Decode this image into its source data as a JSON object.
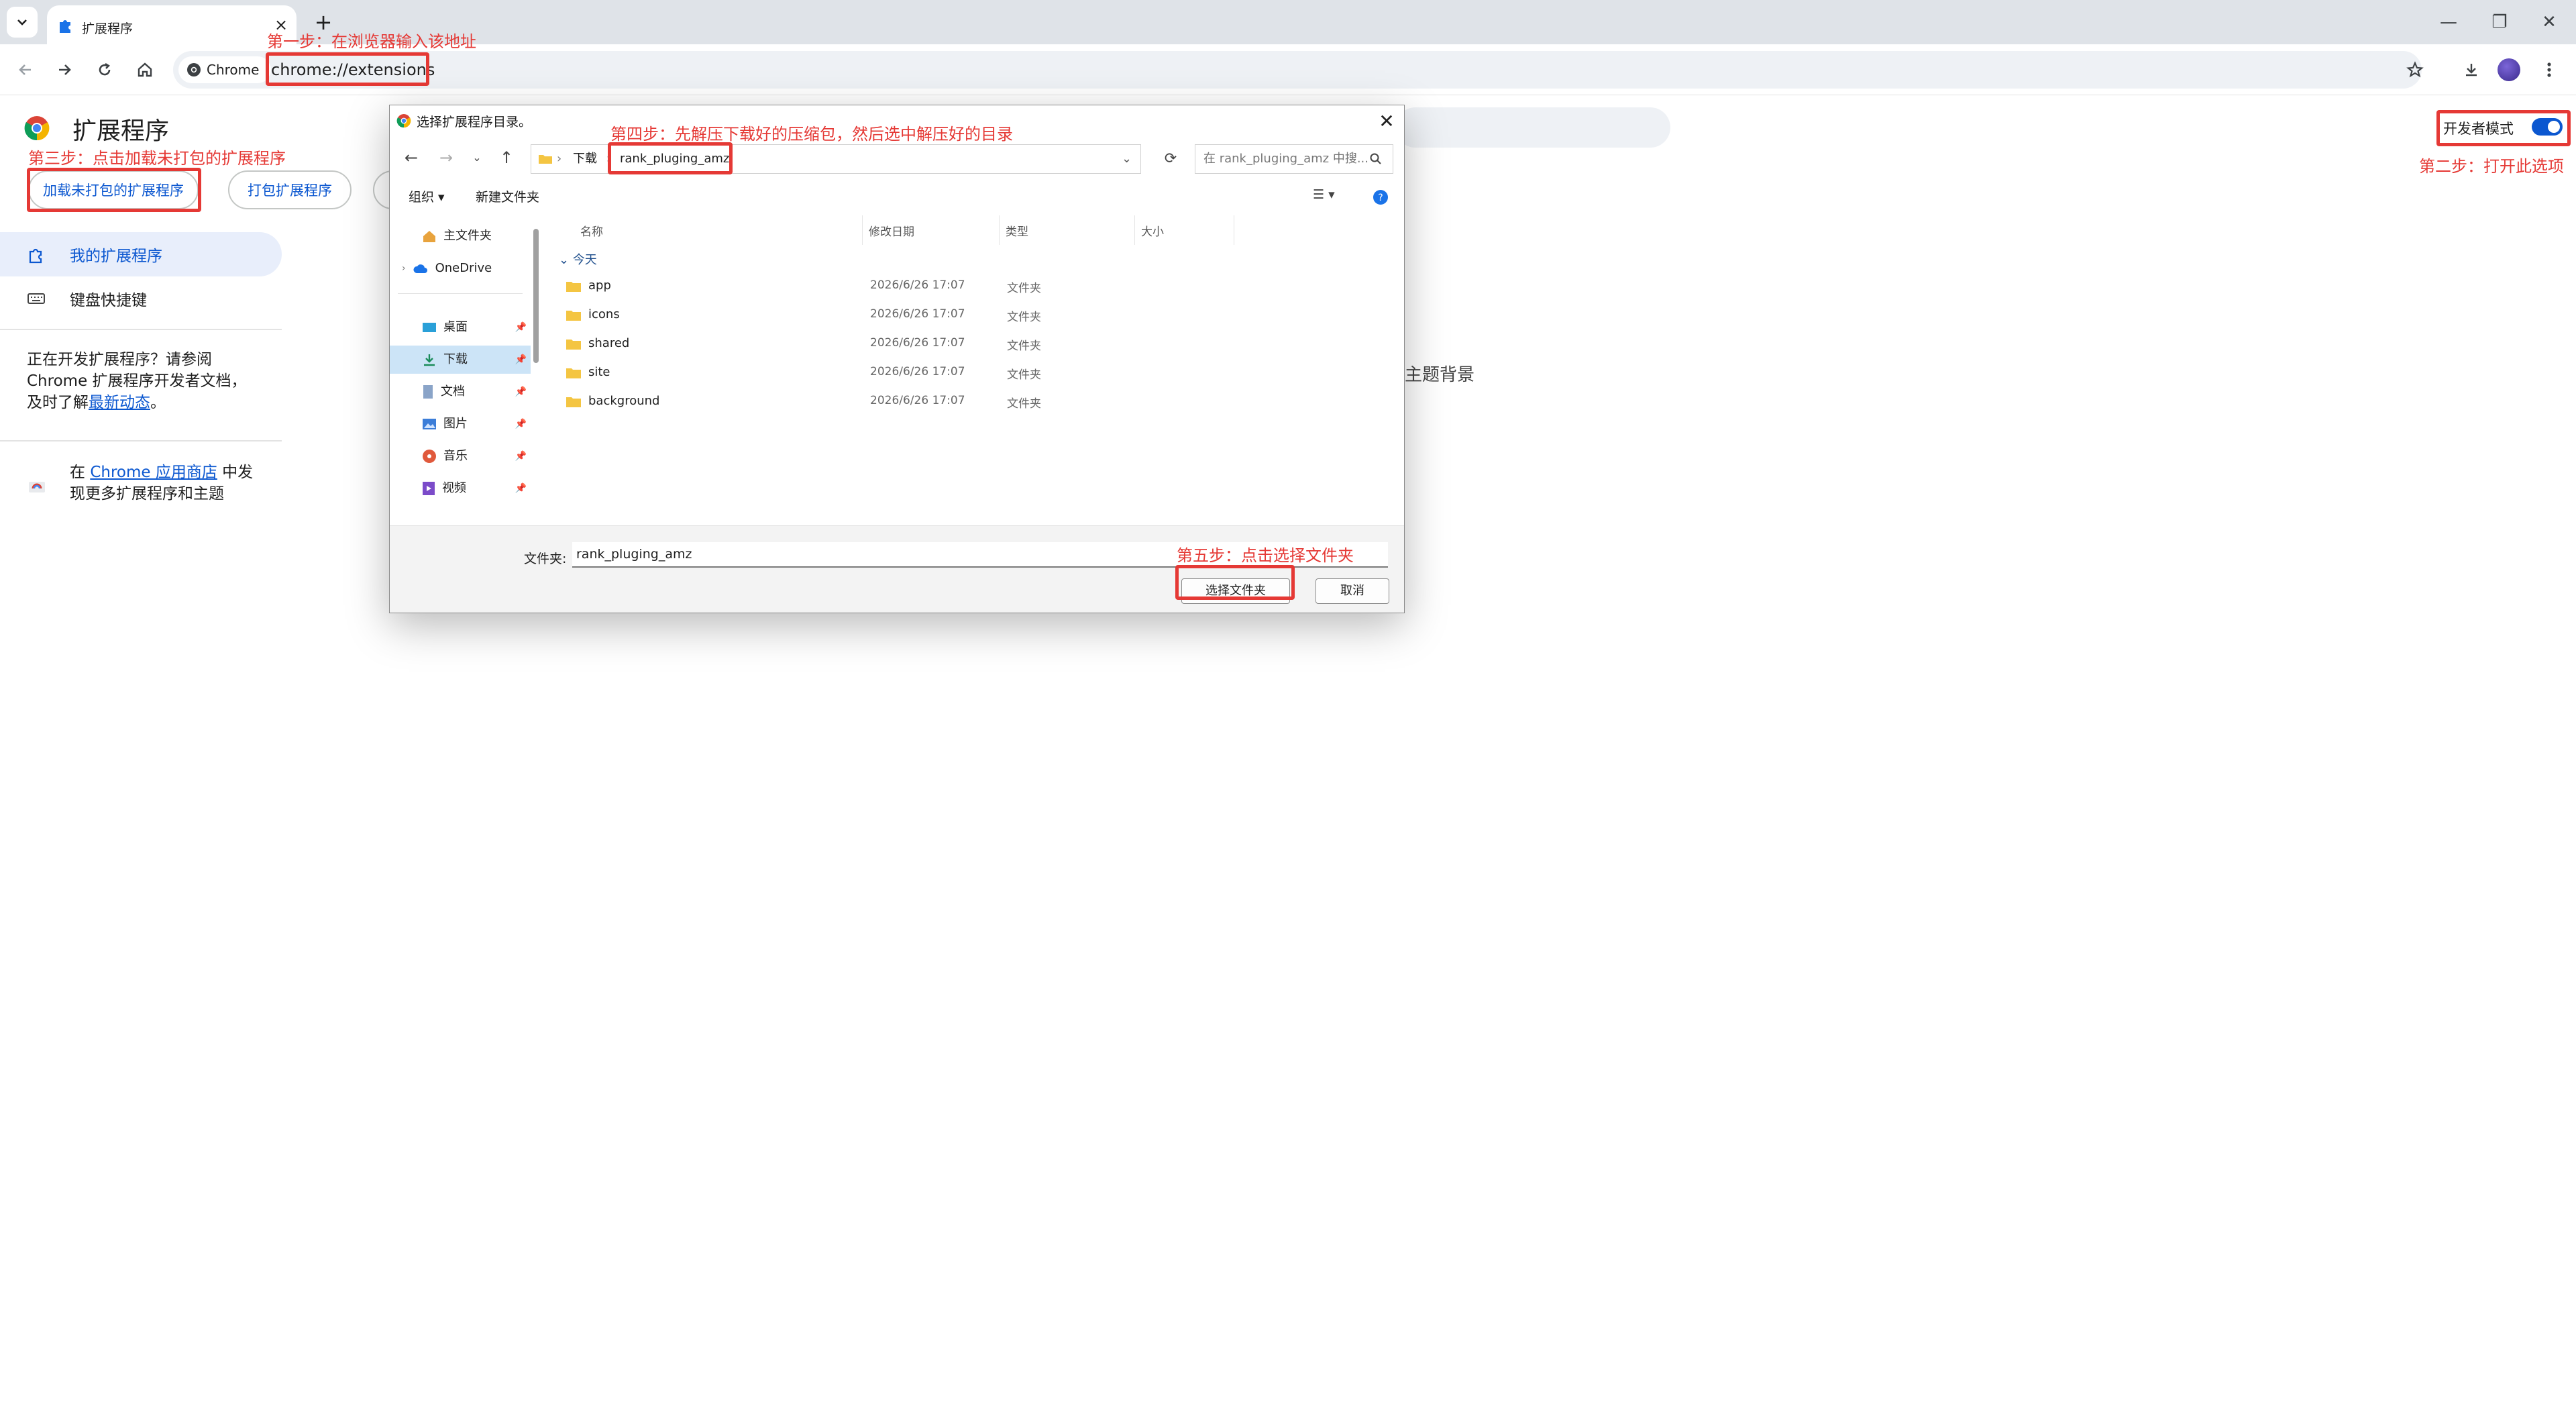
{
  "browser": {
    "tab_title": "扩展程序",
    "tab_close": "×",
    "new_tab": "+",
    "chip_label": "Chrome",
    "url": "chrome://extensions",
    "window_controls": {
      "minimize": "—",
      "restore": "❐",
      "close": "✕"
    }
  },
  "page": {
    "title": "扩展程序",
    "buttons": {
      "load_unpacked": "加载未打包的扩展程序",
      "pack": "打包扩展程序"
    },
    "sidebar": {
      "items": [
        {
          "label": "我的扩展程序",
          "icon": "puzzle-icon",
          "selected": true
        },
        {
          "label": "键盘快捷键",
          "icon": "keyboard-icon",
          "selected": false
        }
      ],
      "dev_note_1": "正在开发扩展程序？请参阅",
      "dev_note_2": "Chrome 扩展程序开发者文档，",
      "dev_note_3": "及时了解",
      "dev_note_link": "最新动态",
      "dev_note_end": "。",
      "store_pre": "在 ",
      "store_link": "Chrome 应用商店",
      "store_mid": " 中发",
      "store_line2": "现更多扩展程序和主题"
    },
    "dev_mode_label": "开发者模式",
    "dev_mode_on": true,
    "behind_text": "主题背景"
  },
  "annotations": {
    "step1": "第一步：在浏览器输入该地址",
    "step2": "第二步：打开此选项",
    "step3": "第三步：点击加载未打包的扩展程序",
    "step4": "第四步：先解压下载好的压缩包，然后选中解压好的目录",
    "step5": "第五步：点击选择文件夹"
  },
  "dialog": {
    "title": "选择扩展程序目录。",
    "breadcrumb": [
      "下载",
      "rank_pluging_amz"
    ],
    "search_placeholder": "在 rank_pluging_amz 中搜...",
    "commands": {
      "organize": "组织 ▾",
      "new_folder": "新建文件夹"
    },
    "nav": [
      {
        "label": "主文件夹",
        "icon": "home-icon"
      },
      {
        "label": "OneDrive",
        "icon": "cloud-icon"
      },
      {
        "label": "桌面",
        "icon": "desktop-icon"
      },
      {
        "label": "下载",
        "icon": "download-icon"
      },
      {
        "label": "文档",
        "icon": "document-icon"
      },
      {
        "label": "图片",
        "icon": "picture-icon"
      },
      {
        "label": "音乐",
        "icon": "music-icon"
      },
      {
        "label": "视频",
        "icon": "video-icon"
      }
    ],
    "columns": {
      "name": "名称",
      "date": "修改日期",
      "type": "类型",
      "size": "大小"
    },
    "group": "今天",
    "files": [
      {
        "name": "app",
        "date": "2026/6/26 17:07",
        "type": "文件夹"
      },
      {
        "name": "icons",
        "date": "2026/6/26 17:07",
        "type": "文件夹"
      },
      {
        "name": "shared",
        "date": "2026/6/26 17:07",
        "type": "文件夹"
      },
      {
        "name": "site",
        "date": "2026/6/26 17:07",
        "type": "文件夹"
      },
      {
        "name": "background",
        "date": "2026/6/26 17:07",
        "type": "文件夹"
      }
    ],
    "folder_label": "文件夹:",
    "folder_value": "rank_pluging_amz",
    "select_button": "选择文件夹",
    "cancel_button": "取消"
  },
  "colors": {
    "accent": "#0b57d0",
    "annotation": "#e53935",
    "folder": "#f4c542"
  }
}
